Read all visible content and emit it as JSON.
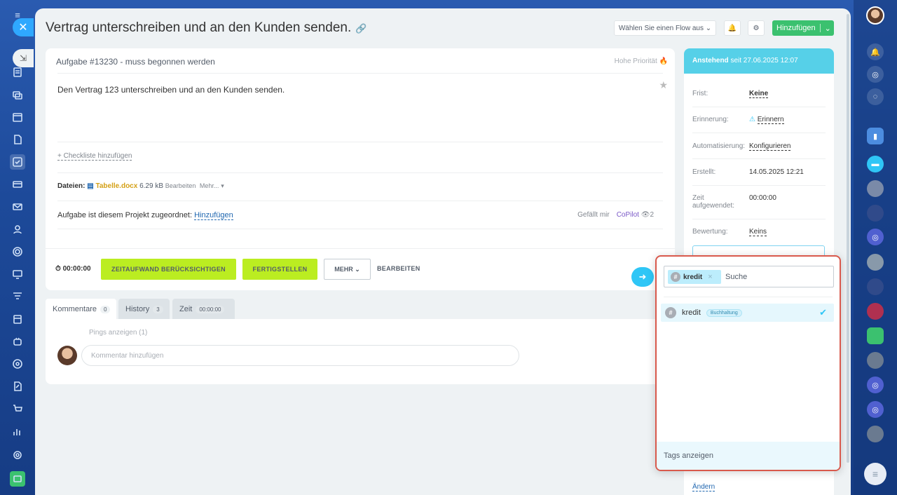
{
  "task": {
    "title": "Vertrag unterschreiben und an den Kunden senden.",
    "number_status": "Aufgabe #13230 - muss begonnen werden",
    "priority": "Hohe Priorität",
    "description": "Den Vertrag 123 unterschreiben und an den Kunden senden.",
    "checklist_link": "+ Checkliste hinzufügen",
    "files_label": "Dateien:",
    "file_name": "Tabelle.docx",
    "file_size": "6.29 kB",
    "file_edit": "Bearbeiten",
    "file_more": "Mehr...",
    "project_text": "Aufgabe ist diesem Projekt zugeordnet:",
    "project_link": "Hinzufügen",
    "likes": "Gefällt mir",
    "copilot": "CoPilot",
    "views": "2"
  },
  "header": {
    "flow_select": "Wählen Sie einen Flow aus",
    "add_button": "Hinzufügen"
  },
  "actions": {
    "timer": "00:00:00",
    "track_time": "ZEITAUFWAND BERÜCKSICHTIGEN",
    "complete": "FERTIGSTELLEN",
    "more": "MEHR",
    "edit": "BEARBEITEN"
  },
  "tabs": [
    {
      "label": "Kommentare",
      "count": "0"
    },
    {
      "label": "History",
      "count": "3"
    },
    {
      "label": "Zeit",
      "count": "00:00:00"
    }
  ],
  "comments": {
    "pings": "Pings anzeigen (1)",
    "placeholder": "Kommentar hinzufügen"
  },
  "sidebar": {
    "status": "Anstehend",
    "since": "seit 27.06.2025 12:07",
    "fields": [
      {
        "label": "Frist:",
        "value": "Keine"
      },
      {
        "label": "Erinnerung:",
        "value": "Erinnern"
      },
      {
        "label": "Automatisierung:",
        "value": "Konfigurieren"
      },
      {
        "label": "Erstellt:",
        "value": "14.05.2025 12:21"
      },
      {
        "label": "Zeit aufgewendet:",
        "value": "00:00:00"
      },
      {
        "label": "Bewertung:",
        "value": "Keins"
      }
    ],
    "change_link": "Ändern"
  },
  "tag_popup": {
    "selected_tag": "kredit",
    "search_placeholder": "Suche",
    "result_tag": "kredit",
    "result_group": "Buchhaltung",
    "footer": "Tags anzeigen"
  },
  "colors": {
    "accent": "#2fc6f6",
    "green": "#3bc16f",
    "lime": "#bbed21",
    "popup_border": "#d9594c"
  }
}
